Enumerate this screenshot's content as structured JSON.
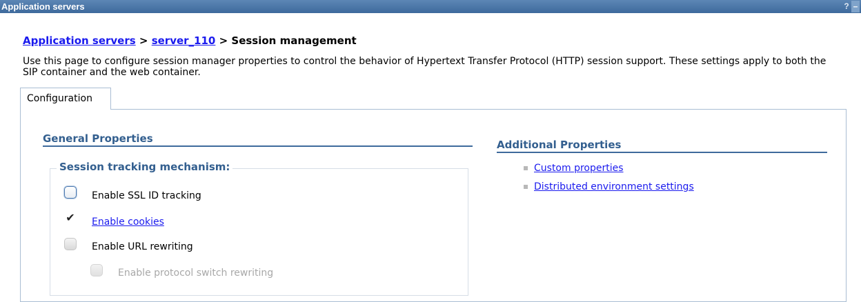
{
  "window": {
    "title": "Application servers",
    "help_label": "?",
    "minimize_label": "–"
  },
  "breadcrumb": {
    "link1": "Application servers",
    "sep1": " > ",
    "link2": "server_110",
    "sep2": " > ",
    "current": "Session management"
  },
  "description": "Use this page to configure session manager properties to control the behavior of Hypertext Transfer Protocol (HTTP) session support. These settings apply to both the SIP container and the web container.",
  "tabs": [
    {
      "label": "Configuration"
    }
  ],
  "general": {
    "title": "General Properties",
    "tracking": {
      "legend": "Session tracking mechanism:",
      "options": [
        {
          "label": "Enable SSL ID tracking",
          "checked": false
        },
        {
          "label": "Enable cookies",
          "checked": true,
          "link": true,
          "check_glyph": "✔"
        },
        {
          "label": "Enable URL rewriting",
          "checked": false
        },
        {
          "label": "Enable protocol switch rewriting",
          "checked": false,
          "disabled": true
        }
      ]
    }
  },
  "additional": {
    "title": "Additional Properties",
    "links": [
      {
        "label": "Custom properties"
      },
      {
        "label": "Distributed environment settings"
      }
    ]
  },
  "colors": {
    "titlebar": "#3e6a9c",
    "section_heading": "#335f8f",
    "link": "#1a1aee",
    "panel_border": "#a9bdd3"
  }
}
